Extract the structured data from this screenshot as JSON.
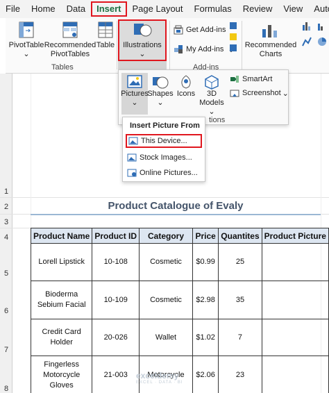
{
  "menubar": {
    "tabs": [
      "File",
      "Home",
      "Data",
      "Insert",
      "Page Layout",
      "Formulas",
      "Review",
      "View",
      "Automate"
    ],
    "active_tab": "Insert"
  },
  "ribbon": {
    "tables_group": {
      "label": "Tables",
      "pivottable": "PivotTable",
      "recommended_pivot_line1": "Recommended",
      "recommended_pivot_line2": "PivotTables",
      "table": "Table"
    },
    "illustrations": "Illustrations",
    "addins_group": {
      "label": "Add-ins",
      "get_addins": "Get Add-ins",
      "my_addins": "My Add-ins"
    },
    "charts": {
      "recommended_line1": "Recommended",
      "recommended_line2": "Charts"
    }
  },
  "illustrations_panel": {
    "pictures": "Pictures",
    "shapes": "Shapes",
    "icons": "Icons",
    "models_line1": "3D",
    "models_line2": "Models",
    "smartart": "SmartArt",
    "screenshot": "Screenshot",
    "group_label_tail": "tions"
  },
  "insert_picture_menu": {
    "header": "Insert Picture From",
    "items": [
      {
        "label": "This Device...",
        "accel": "D"
      },
      {
        "label": "Stock Images...",
        "accel": "S"
      },
      {
        "label": "Online Pictures...",
        "accel": "O"
      }
    ]
  },
  "sheet": {
    "row_numbers": [
      "1",
      "2",
      "3",
      "4",
      "5",
      "6",
      "7",
      "8"
    ],
    "title": "Product Catalogue of Evaly",
    "headers": [
      "Product Name",
      "Product ID",
      "Category",
      "Price",
      "Quantites",
      "Product Picture"
    ],
    "rows": [
      {
        "name_line1": "Lorell Lipstick",
        "name_line2": "",
        "name_line3": "",
        "id": "10-108",
        "category": "Cosmetic",
        "price": "$0.99",
        "qty": "25",
        "picture": ""
      },
      {
        "name_line1": "Bioderma",
        "name_line2": "Sebium Facial",
        "name_line3": "",
        "id": "10-109",
        "category": "Cosmetic",
        "price": "$2.98",
        "qty": "35",
        "picture": ""
      },
      {
        "name_line1": "Credit Card",
        "name_line2": "Holder",
        "name_line3": "",
        "id": "20-026",
        "category": "Wallet",
        "price": "$1.02",
        "qty": "7",
        "picture": ""
      },
      {
        "name_line1": "Fingerless",
        "name_line2": "Motorcycle",
        "name_line3": "Gloves",
        "id": "21-003",
        "category": "Motorcycle",
        "price": "$2.06",
        "qty": "23",
        "picture": ""
      }
    ]
  },
  "watermark": {
    "text": "exceldemy",
    "sub": "EXCEL · DATA · BI"
  },
  "colors": {
    "highlight_red": "#e0161e",
    "excel_green": "#1d6f42",
    "header_fill": "#dde6f1",
    "title_color": "#44546a"
  }
}
